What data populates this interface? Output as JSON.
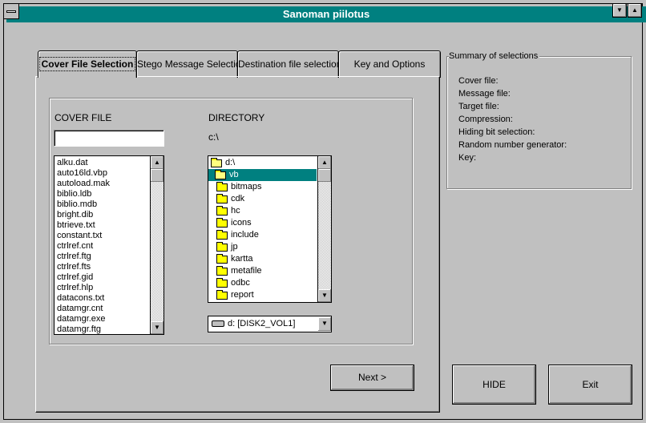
{
  "window": {
    "title": "Sanoman piilotus",
    "minimize_glyph": "▼",
    "maximize_glyph": "▲"
  },
  "tabs": [
    {
      "label": "Cover File Selection",
      "active": true
    },
    {
      "label": "Stego Message Selection",
      "active": false
    },
    {
      "label": "Destination file selection",
      "active": false
    },
    {
      "label": "Key and Options",
      "active": false
    }
  ],
  "cover": {
    "cover_file_label": "COVER FILE",
    "filename_value": "",
    "directory_label": "DIRECTORY",
    "current_path": "c:\\",
    "files": [
      "alku.dat",
      "auto16ld.vbp",
      "autoload.mak",
      "biblio.ldb",
      "biblio.mdb",
      "bright.dib",
      "btrieve.txt",
      "constant.txt",
      "ctrlref.cnt",
      "ctrlref.ftg",
      "ctrlref.fts",
      "ctrlref.gid",
      "ctrlref.hlp",
      "datacons.txt",
      "datamgr.cnt",
      "datamgr.exe",
      "datamgr.ftg"
    ],
    "directories": [
      {
        "name": "d:\\",
        "open": true,
        "selected": false
      },
      {
        "name": "vb",
        "open": true,
        "selected": true
      },
      {
        "name": "bitmaps",
        "open": false,
        "selected": false
      },
      {
        "name": "cdk",
        "open": false,
        "selected": false
      },
      {
        "name": "hc",
        "open": false,
        "selected": false
      },
      {
        "name": "icons",
        "open": false,
        "selected": false
      },
      {
        "name": "include",
        "open": false,
        "selected": false
      },
      {
        "name": "jp",
        "open": false,
        "selected": false
      },
      {
        "name": "kartta",
        "open": false,
        "selected": false
      },
      {
        "name": "metafile",
        "open": false,
        "selected": false
      },
      {
        "name": "odbc",
        "open": false,
        "selected": false
      },
      {
        "name": "report",
        "open": false,
        "selected": false
      }
    ],
    "drive_value": "d: [DISK2_VOL1]",
    "next_label": "Next >"
  },
  "summary": {
    "title": "Summary of selections",
    "lines": [
      "Cover file:",
      "Message file:",
      "Target file:",
      "Compression:",
      "Hiding bit selection:",
      "Random number generator:",
      "Key:"
    ]
  },
  "buttons": {
    "hide_label": "HIDE",
    "exit_label": "Exit"
  },
  "scroll": {
    "up_glyph": "▲",
    "down_glyph": "▼"
  }
}
